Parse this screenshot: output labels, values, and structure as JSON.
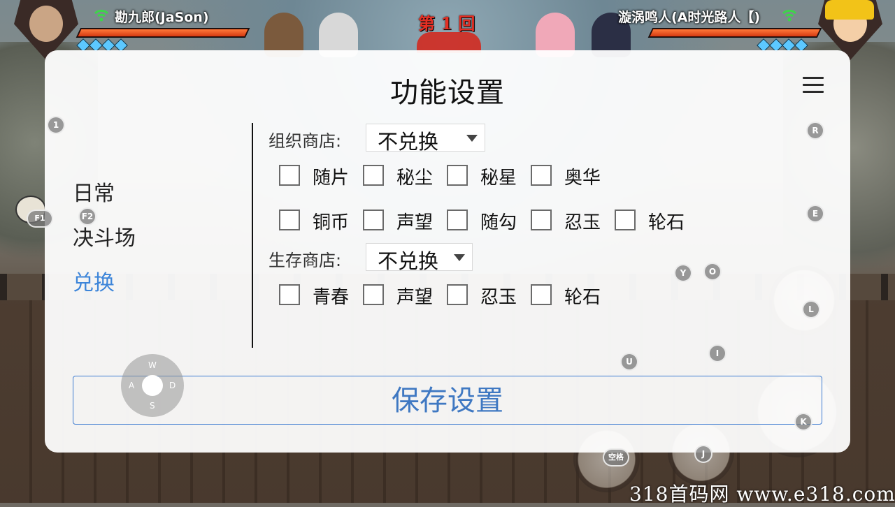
{
  "hud": {
    "player_left": {
      "name": "勘九郎(JaSon)",
      "hp_percent": 100,
      "chakra": 4
    },
    "player_right": {
      "name": "漩涡鸣人(A时光路人【)",
      "hp_percent": 100,
      "chakra": 4
    },
    "round_title": "第 1 回"
  },
  "dialog": {
    "title": "功能设置",
    "menu_icon": "hamburger-menu-icon",
    "nav": [
      {
        "label": "日常",
        "active": false
      },
      {
        "label": "决斗场",
        "active": false
      },
      {
        "label": "兑换",
        "active": true
      }
    ],
    "org_shop": {
      "label": "组织商店:",
      "selected": "不兑换",
      "row1": [
        "随片",
        "秘尘",
        "秘星",
        "奥华"
      ],
      "row2": [
        "铜币",
        "声望",
        "随勾",
        "忍玉",
        "轮石"
      ]
    },
    "survival_shop": {
      "label": "生存商店:",
      "selected": "不兑换",
      "items": [
        "青春",
        "声望",
        "忍玉",
        "轮石"
      ]
    },
    "save_button": "保存设置"
  },
  "keys": {
    "k1": "1",
    "f1": "F1",
    "f2": "F2",
    "r": "R",
    "e": "E",
    "y": "Y",
    "o": "O",
    "l": "L",
    "i": "I",
    "u": "U",
    "k": "K",
    "j": "J",
    "space": "空格",
    "dpad": {
      "up": "W",
      "left": "A",
      "right": "D",
      "down": "S"
    }
  },
  "watermark": "318首码网 www.e318.com",
  "colors": {
    "accent": "#3d85d9",
    "save_text": "#3f78c2",
    "hp": "#d63a12",
    "round": "#e52f24"
  }
}
